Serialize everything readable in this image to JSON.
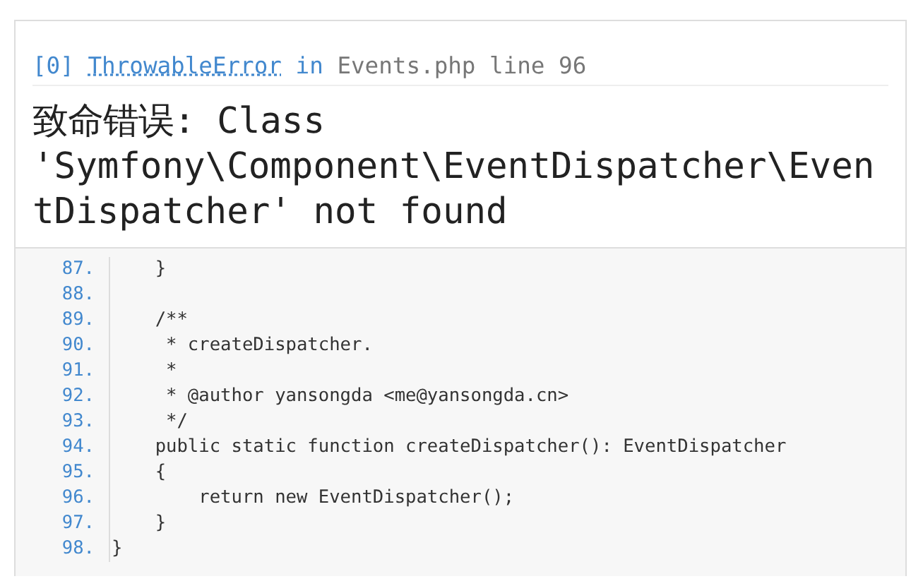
{
  "exception": {
    "index": "[0]",
    "class_name": "ThrowableError",
    "connector": "in",
    "location": "Events.php line 96",
    "message": "致命错误: Class 'Symfony\\Component\\EventDispatcher\\EventDispatcher' not found"
  },
  "source": {
    "lines": [
      {
        "number": "87.",
        "code": "    }"
      },
      {
        "number": "88."
      },
      {
        "number": "89.",
        "code": "    /**"
      },
      {
        "number": "90.",
        "code": "     * createDispatcher."
      },
      {
        "number": "91.",
        "code": "     *"
      },
      {
        "number": "92.",
        "code": "     * @author yansongda <me@yansongda.cn>"
      },
      {
        "number": "93.",
        "code": "     */"
      },
      {
        "number": "94.",
        "code": "    public static function createDispatcher(): EventDispatcher"
      },
      {
        "number": "95.",
        "code": "    {"
      },
      {
        "number": "96.",
        "code": "        return new EventDispatcher();"
      },
      {
        "number": "97.",
        "code": "    }"
      },
      {
        "number": "98.",
        "code": "}"
      }
    ]
  }
}
